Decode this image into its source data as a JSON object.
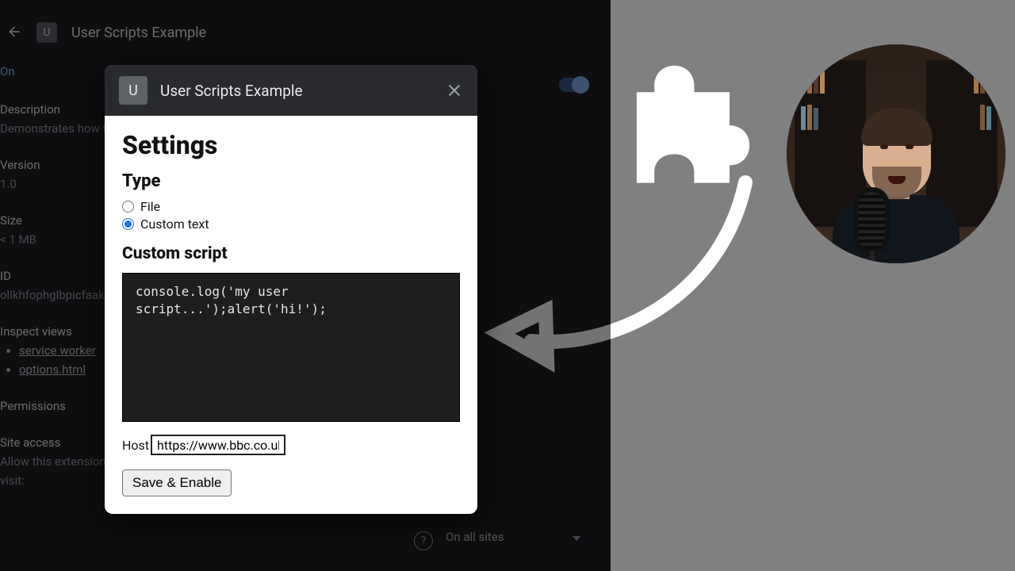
{
  "bg": {
    "icon_letter": "U",
    "title": "User Scripts Example",
    "on_label": "On",
    "toggle_on": true,
    "description_label": "Description",
    "description_value": "Demonstrates how t",
    "version_label": "Version",
    "version_value": "1.0",
    "size_label": "Size",
    "size_value": "< 1 MB",
    "id_label": "ID",
    "id_value": "ollkhfophglbpicfaak",
    "inspect_label": "Inspect views",
    "inspect_links": [
      "service worker",
      "options.html"
    ],
    "permissions_label": "Permissions",
    "site_access_label": "Site access",
    "site_access_desc": "Allow this extension to read and change all your data on websites that you visit:",
    "site_access_select": "On all sites"
  },
  "dialog": {
    "icon_letter": "U",
    "title": "User Scripts Example",
    "h_settings": "Settings",
    "h_type": "Type",
    "radio_file": "File",
    "radio_custom": "Custom text",
    "selected_type": "custom",
    "h_custom": "Custom script",
    "script": "console.log('my user\nscript...');alert('hi!');",
    "host_label": "Host",
    "host_value": "https://www.bbc.co.uk/*",
    "save_label": "Save & Enable"
  }
}
